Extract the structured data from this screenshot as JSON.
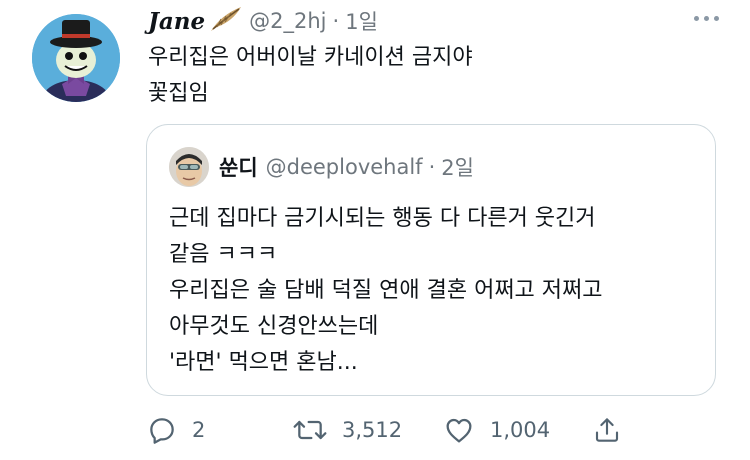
{
  "tweet": {
    "author": {
      "display_name": "Jane",
      "handle": "@2_2hj",
      "separator": "·",
      "time": "1일"
    },
    "text_lines": [
      "우리집은 어버이날 카네이션 금지야",
      "꽃집임"
    ]
  },
  "quoted_tweet": {
    "author": {
      "display_name": "쑨디",
      "handle": "@deeplovehalf",
      "separator": "·",
      "time": "2일"
    },
    "text_lines": [
      "근데 집마다 금기시되는 행동 다 다른거 웃긴거",
      "같음 ㅋㅋㅋ",
      "우리집은 술 담배 덕질 연애 결혼 어쩌고 저쩌고",
      "아무것도 신경안쓰는데",
      "'라면' 먹으면 혼남..."
    ]
  },
  "actions": {
    "reply_count": "2",
    "retweet_count": "3,512",
    "like_count": "1,004"
  },
  "icons": {
    "more": "more-dots-icon",
    "reply": "reply-bubble-icon",
    "retweet": "retweet-icon",
    "like": "heart-icon",
    "share": "share-icon",
    "badge": "feather-emoji"
  },
  "colors": {
    "text": "#0f1419",
    "secondary": "#536471",
    "border": "#cfd9de"
  }
}
